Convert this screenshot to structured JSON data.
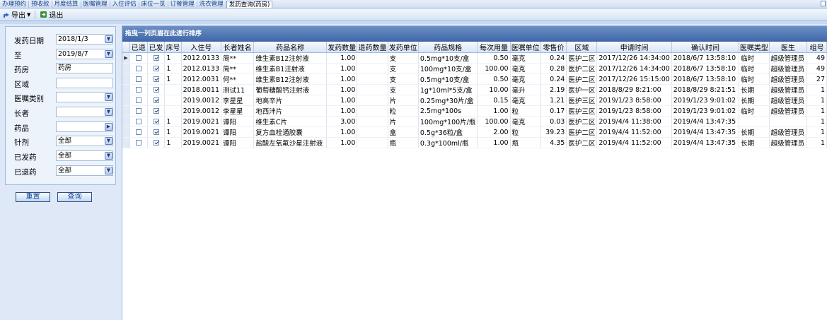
{
  "tabs": [
    {
      "label": "办理预约",
      "active": false
    },
    {
      "label": "预收款",
      "active": false
    },
    {
      "label": "月度结算",
      "active": false
    },
    {
      "label": "医嘱管理",
      "active": false
    },
    {
      "label": "入住评估",
      "active": false
    },
    {
      "label": "床位一览",
      "active": false
    },
    {
      "label": "订餐管理",
      "active": false
    },
    {
      "label": "洗衣管理",
      "active": false
    },
    {
      "label": "发药查询(药房)",
      "active": true
    }
  ],
  "toolbar": {
    "export_label": "导出",
    "exit_label": "退出"
  },
  "filter": {
    "fields": [
      {
        "name": "dispense-date-from",
        "label": "发药日期",
        "value": "2018/1/3",
        "button": "dropdown"
      },
      {
        "name": "dispense-date-to",
        "label": "至",
        "value": "2019/8/7",
        "button": "dropdown"
      },
      {
        "name": "pharmacy",
        "label": "药房",
        "value": "药房",
        "button": "none"
      },
      {
        "name": "area",
        "label": "区域",
        "value": "",
        "button": "none"
      },
      {
        "name": "order-type",
        "label": "医嘱类别",
        "value": "",
        "button": "dropdown"
      },
      {
        "name": "elder",
        "label": "长者",
        "value": "",
        "button": "dropdown"
      },
      {
        "name": "drug",
        "label": "药品",
        "value": "",
        "button": "browse"
      },
      {
        "name": "injection",
        "label": "针剂",
        "value": "全部",
        "button": "dropdown"
      },
      {
        "name": "dispensed",
        "label": "已发药",
        "value": "全部",
        "button": "dropdown"
      },
      {
        "name": "returned",
        "label": "已退药",
        "value": "全部",
        "button": "dropdown"
      }
    ],
    "reset_label": "重置",
    "query_label": "查询"
  },
  "grid": {
    "group_hint": "拖曳一列页眉在此进行排序",
    "columns": [
      "已退",
      "已发",
      "床号",
      "入住号",
      "长者姓名",
      "药品名称",
      "发药数量",
      "退药数量",
      "发药单位",
      "药品规格",
      "每次用量",
      "医嘱单位",
      "零售价",
      "区域",
      "申请时间",
      "确认时间",
      "医嘱类型",
      "医生",
      "组号"
    ],
    "rows": [
      {
        "current": true,
        "returned": false,
        "dispensed": true,
        "bed": "1",
        "admit_no": "2012.0133",
        "name": "简**",
        "drug": "维生素B12注射液",
        "qty": "1.00",
        "return_qty": "",
        "unit": "支",
        "spec": "0.5mg*10支/盒",
        "dose": "0.50",
        "order_unit": "毫克",
        "price": "0.24",
        "area": "医护二区",
        "apply_time": "2017/12/26 14:34:00",
        "confirm_time": "2018/6/7 13:58:10",
        "order_type": "临时",
        "doctor": "超级管理员",
        "group": "49"
      },
      {
        "current": false,
        "returned": false,
        "dispensed": true,
        "bed": "1",
        "admit_no": "2012.0133",
        "name": "简**",
        "drug": "维生素B1注射液",
        "qty": "1.00",
        "return_qty": "",
        "unit": "支",
        "spec": "100mg*10支/盒",
        "dose": "100.00",
        "order_unit": "毫克",
        "price": "0.28",
        "area": "医护二区",
        "apply_time": "2017/12/26 14:34:00",
        "confirm_time": "2018/6/7 13:58:10",
        "order_type": "临时",
        "doctor": "超级管理员",
        "group": "49"
      },
      {
        "current": false,
        "returned": false,
        "dispensed": true,
        "bed": "1",
        "admit_no": "2012.0031",
        "name": "何**",
        "drug": "维生素B12注射液",
        "qty": "1.00",
        "return_qty": "",
        "unit": "支",
        "spec": "0.5mg*10支/盒",
        "dose": "0.50",
        "order_unit": "毫克",
        "price": "0.24",
        "area": "医护二区",
        "apply_time": "2017/12/26 15:15:00",
        "confirm_time": "2018/6/7 13:58:10",
        "order_type": "临时",
        "doctor": "超级管理员",
        "group": "27"
      },
      {
        "current": false,
        "returned": false,
        "dispensed": true,
        "bed": "",
        "admit_no": "2018.0011",
        "name": "测试11",
        "drug": "葡萄糖酸钙注射液",
        "qty": "1.00",
        "return_qty": "",
        "unit": "支",
        "spec": "1g*10ml*5支/盒",
        "dose": "10.00",
        "order_unit": "毫升",
        "price": "2.19",
        "area": "医护一区",
        "apply_time": "2018/8/29 8:21:00",
        "confirm_time": "2018/8/29 8:21:51",
        "order_type": "长期",
        "doctor": "超级管理员",
        "group": "1"
      },
      {
        "current": false,
        "returned": false,
        "dispensed": true,
        "bed": "",
        "admit_no": "2019.0012",
        "name": "李星星",
        "drug": "地高辛片",
        "qty": "1.00",
        "return_qty": "",
        "unit": "片",
        "spec": "0.25mg*30片/盒",
        "dose": "0.15",
        "order_unit": "毫克",
        "price": "1.21",
        "area": "医护三区",
        "apply_time": "2019/1/23 8:58:00",
        "confirm_time": "2019/1/23 9:01:02",
        "order_type": "长期",
        "doctor": "超级管理员",
        "group": "1"
      },
      {
        "current": false,
        "returned": false,
        "dispensed": true,
        "bed": "",
        "admit_no": "2019.0012",
        "name": "李星星",
        "drug": "地西泮片",
        "qty": "1.00",
        "return_qty": "",
        "unit": "粒",
        "spec": "2.5mg*100s",
        "dose": "1.00",
        "order_unit": "粒",
        "price": "0.17",
        "area": "医护三区",
        "apply_time": "2019/1/23 8:58:00",
        "confirm_time": "2019/1/23 9:01:02",
        "order_type": "临时",
        "doctor": "超级管理员",
        "group": "1"
      },
      {
        "current": false,
        "returned": false,
        "dispensed": true,
        "bed": "1",
        "admit_no": "2019.0021",
        "name": "谭阳",
        "drug": "维生素C片",
        "qty": "3.00",
        "return_qty": "",
        "unit": "片",
        "spec": "100mg*100片/瓶",
        "dose": "100.00",
        "order_unit": "毫克",
        "price": "0.03",
        "area": "医护二区",
        "apply_time": "2019/4/4 11:38:00",
        "confirm_time": "2019/4/4 13:47:35",
        "order_type": "",
        "doctor": "",
        "group": "1"
      },
      {
        "current": false,
        "returned": false,
        "dispensed": true,
        "bed": "1",
        "admit_no": "2019.0021",
        "name": "谭阳",
        "drug": "复方血栓通胶囊",
        "qty": "1.00",
        "return_qty": "",
        "unit": "盒",
        "spec": "0.5g*36粒/盒",
        "dose": "2.00",
        "order_unit": "粒",
        "price": "39.23",
        "area": "医护二区",
        "apply_time": "2019/4/4 11:52:00",
        "confirm_time": "2019/4/4 13:47:35",
        "order_type": "长期",
        "doctor": "超级管理员",
        "group": "1"
      },
      {
        "current": false,
        "returned": false,
        "dispensed": true,
        "bed": "1",
        "admit_no": "2019.0021",
        "name": "谭阳",
        "drug": "盐酸左氧氟沙星注射液",
        "qty": "1.00",
        "return_qty": "",
        "unit": "瓶",
        "spec": "0.3g*100ml/瓶",
        "dose": "1.00",
        "order_unit": "瓶",
        "price": "4.35",
        "area": "医护二区",
        "apply_time": "2019/4/4 11:52:00",
        "confirm_time": "2019/4/4 13:47:35",
        "order_type": "长期",
        "doctor": "超级管理员",
        "group": "1"
      }
    ]
  },
  "colors": {
    "header_blue": "#3f66a8",
    "panel_bg": "#dfe8f6",
    "border": "#99bbe8"
  }
}
